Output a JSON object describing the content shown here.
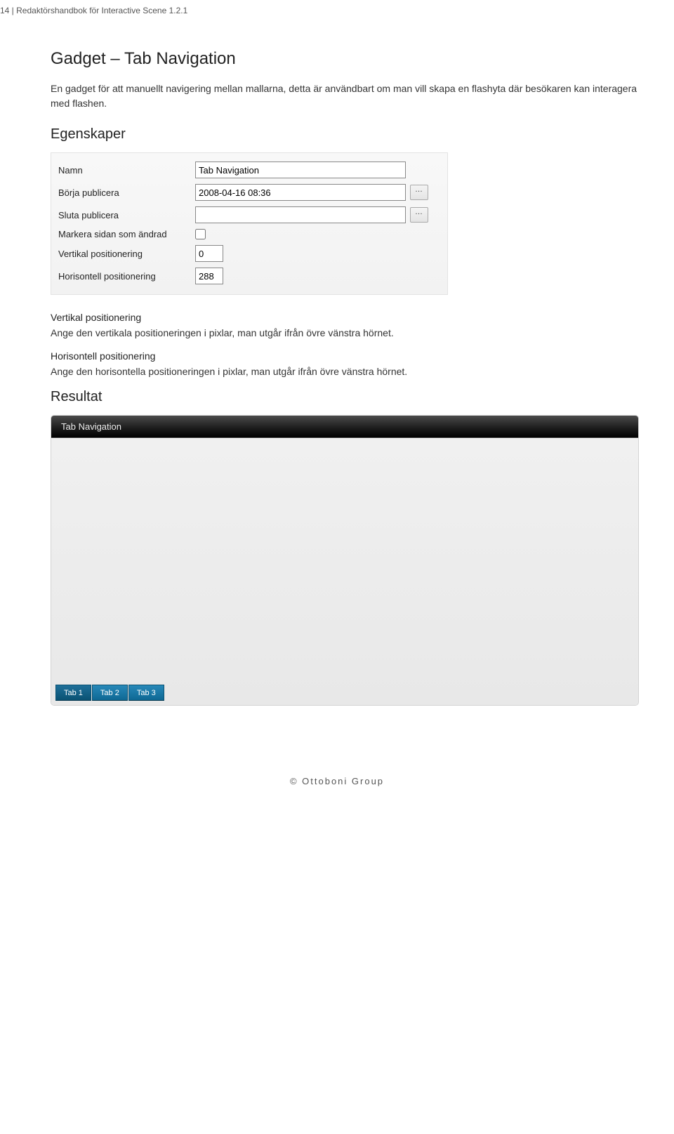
{
  "header": "14 | Redaktörshandbok för Interactive Scene 1.2.1",
  "section": {
    "title": "Gadget – Tab Navigation",
    "intro": "En gadget för att manuellt navigering mellan mallarna, detta är användbart om man vill skapa en flashyta där besökaren kan interagera med flashen."
  },
  "egenskaper": {
    "title": "Egenskaper",
    "fields": {
      "namn": {
        "label": "Namn",
        "value": "Tab Navigation"
      },
      "borja": {
        "label": "Börja publicera",
        "value": "2008-04-16 08:36"
      },
      "sluta": {
        "label": "Sluta publicera",
        "value": ""
      },
      "markera": {
        "label": "Markera sidan som ändrad"
      },
      "vertikal": {
        "label": "Vertikal positionering",
        "value": "0"
      },
      "horisontell": {
        "label": "Horisontell positionering",
        "value": "288"
      }
    }
  },
  "descriptions": {
    "vertikal": {
      "head": "Vertikal positionering",
      "text": "Ange den vertikala positioneringen i pixlar, man utgår ifrån övre vänstra hörnet."
    },
    "horisontell": {
      "head": "Horisontell positionering",
      "text": "Ange den horisontella positioneringen i pixlar, man utgår ifrån övre vänstra hörnet."
    }
  },
  "resultat": {
    "title": "Resultat",
    "header": "Tab Navigation",
    "tabs": [
      "Tab 1",
      "Tab 2",
      "Tab 3"
    ]
  },
  "footer": "© Ottoboni Group"
}
